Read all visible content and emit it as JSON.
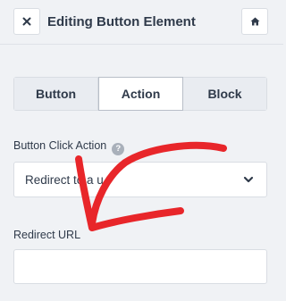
{
  "header": {
    "title": "Editing Button Element",
    "close_icon": "close-icon",
    "home_icon": "home-icon"
  },
  "tabs": [
    {
      "label": "Button",
      "active": false
    },
    {
      "label": "Action",
      "active": true
    },
    {
      "label": "Block",
      "active": false
    }
  ],
  "click_action": {
    "label": "Button Click Action",
    "help_icon": "?",
    "selected_value": "Redirect to a u"
  },
  "redirect_url": {
    "label": "Redirect URL",
    "value": "",
    "placeholder": ""
  },
  "colors": {
    "annotation_arrow": "#e8262a",
    "background": "#f0f2f5",
    "text": "#2f3a4a"
  }
}
